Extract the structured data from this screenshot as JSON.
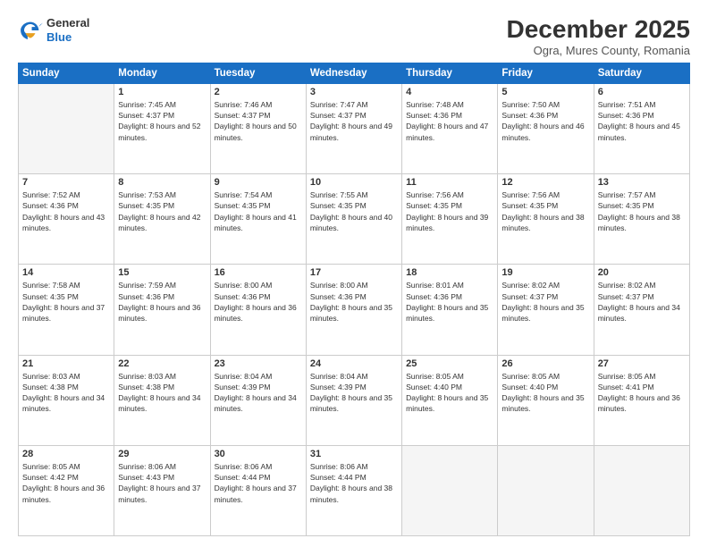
{
  "logo": {
    "line1": "General",
    "line2": "Blue"
  },
  "header": {
    "title": "December 2025",
    "subtitle": "Ogra, Mures County, Romania"
  },
  "weekdays": [
    "Sunday",
    "Monday",
    "Tuesday",
    "Wednesday",
    "Thursday",
    "Friday",
    "Saturday"
  ],
  "weeks": [
    [
      {
        "day": "",
        "empty": true
      },
      {
        "day": "1",
        "sunrise": "7:45 AM",
        "sunset": "4:37 PM",
        "daylight": "8 hours and 52 minutes."
      },
      {
        "day": "2",
        "sunrise": "7:46 AM",
        "sunset": "4:37 PM",
        "daylight": "8 hours and 50 minutes."
      },
      {
        "day": "3",
        "sunrise": "7:47 AM",
        "sunset": "4:37 PM",
        "daylight": "8 hours and 49 minutes."
      },
      {
        "day": "4",
        "sunrise": "7:48 AM",
        "sunset": "4:36 PM",
        "daylight": "8 hours and 47 minutes."
      },
      {
        "day": "5",
        "sunrise": "7:50 AM",
        "sunset": "4:36 PM",
        "daylight": "8 hours and 46 minutes."
      },
      {
        "day": "6",
        "sunrise": "7:51 AM",
        "sunset": "4:36 PM",
        "daylight": "8 hours and 45 minutes."
      }
    ],
    [
      {
        "day": "7",
        "sunrise": "7:52 AM",
        "sunset": "4:36 PM",
        "daylight": "8 hours and 43 minutes."
      },
      {
        "day": "8",
        "sunrise": "7:53 AM",
        "sunset": "4:35 PM",
        "daylight": "8 hours and 42 minutes."
      },
      {
        "day": "9",
        "sunrise": "7:54 AM",
        "sunset": "4:35 PM",
        "daylight": "8 hours and 41 minutes."
      },
      {
        "day": "10",
        "sunrise": "7:55 AM",
        "sunset": "4:35 PM",
        "daylight": "8 hours and 40 minutes."
      },
      {
        "day": "11",
        "sunrise": "7:56 AM",
        "sunset": "4:35 PM",
        "daylight": "8 hours and 39 minutes."
      },
      {
        "day": "12",
        "sunrise": "7:56 AM",
        "sunset": "4:35 PM",
        "daylight": "8 hours and 38 minutes."
      },
      {
        "day": "13",
        "sunrise": "7:57 AM",
        "sunset": "4:35 PM",
        "daylight": "8 hours and 38 minutes."
      }
    ],
    [
      {
        "day": "14",
        "sunrise": "7:58 AM",
        "sunset": "4:35 PM",
        "daylight": "8 hours and 37 minutes."
      },
      {
        "day": "15",
        "sunrise": "7:59 AM",
        "sunset": "4:36 PM",
        "daylight": "8 hours and 36 minutes."
      },
      {
        "day": "16",
        "sunrise": "8:00 AM",
        "sunset": "4:36 PM",
        "daylight": "8 hours and 36 minutes."
      },
      {
        "day": "17",
        "sunrise": "8:00 AM",
        "sunset": "4:36 PM",
        "daylight": "8 hours and 35 minutes."
      },
      {
        "day": "18",
        "sunrise": "8:01 AM",
        "sunset": "4:36 PM",
        "daylight": "8 hours and 35 minutes."
      },
      {
        "day": "19",
        "sunrise": "8:02 AM",
        "sunset": "4:37 PM",
        "daylight": "8 hours and 35 minutes."
      },
      {
        "day": "20",
        "sunrise": "8:02 AM",
        "sunset": "4:37 PM",
        "daylight": "8 hours and 34 minutes."
      }
    ],
    [
      {
        "day": "21",
        "sunrise": "8:03 AM",
        "sunset": "4:38 PM",
        "daylight": "8 hours and 34 minutes."
      },
      {
        "day": "22",
        "sunrise": "8:03 AM",
        "sunset": "4:38 PM",
        "daylight": "8 hours and 34 minutes."
      },
      {
        "day": "23",
        "sunrise": "8:04 AM",
        "sunset": "4:39 PM",
        "daylight": "8 hours and 34 minutes."
      },
      {
        "day": "24",
        "sunrise": "8:04 AM",
        "sunset": "4:39 PM",
        "daylight": "8 hours and 35 minutes."
      },
      {
        "day": "25",
        "sunrise": "8:05 AM",
        "sunset": "4:40 PM",
        "daylight": "8 hours and 35 minutes."
      },
      {
        "day": "26",
        "sunrise": "8:05 AM",
        "sunset": "4:40 PM",
        "daylight": "8 hours and 35 minutes."
      },
      {
        "day": "27",
        "sunrise": "8:05 AM",
        "sunset": "4:41 PM",
        "daylight": "8 hours and 36 minutes."
      }
    ],
    [
      {
        "day": "28",
        "sunrise": "8:05 AM",
        "sunset": "4:42 PM",
        "daylight": "8 hours and 36 minutes."
      },
      {
        "day": "29",
        "sunrise": "8:06 AM",
        "sunset": "4:43 PM",
        "daylight": "8 hours and 37 minutes."
      },
      {
        "day": "30",
        "sunrise": "8:06 AM",
        "sunset": "4:44 PM",
        "daylight": "8 hours and 37 minutes."
      },
      {
        "day": "31",
        "sunrise": "8:06 AM",
        "sunset": "4:44 PM",
        "daylight": "8 hours and 38 minutes."
      },
      {
        "day": "",
        "empty": true
      },
      {
        "day": "",
        "empty": true
      },
      {
        "day": "",
        "empty": true
      }
    ]
  ]
}
